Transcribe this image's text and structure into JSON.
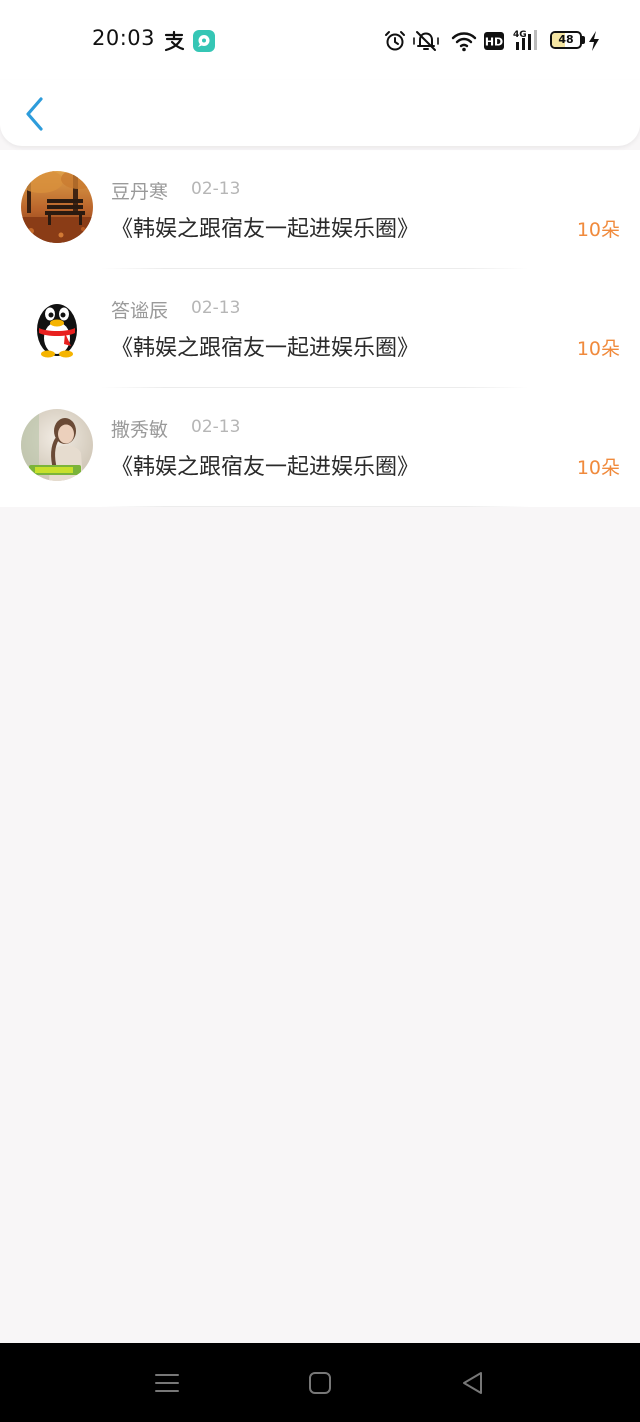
{
  "status_bar": {
    "time": "20:03",
    "battery_level": "48",
    "battery_fraction": 0.48,
    "left_icons": [
      "alipay-icon",
      "chat-app-icon"
    ],
    "right_icons": [
      "alarm-icon",
      "silent-icon",
      "wifi-icon",
      "hd-icon",
      "4g-signal-icon",
      "battery-icon",
      "charging-icon"
    ]
  },
  "header": {
    "back_icon": "chevron-left-icon",
    "accent_color": "#2d9cdb"
  },
  "records": [
    {
      "user": "豆丹寒",
      "date": "02-13",
      "title": "《韩娱之跟宿友一起进娱乐圈》",
      "amount": "10朵",
      "avatar": "autumn-park-bench-avatar"
    },
    {
      "user": "答谧辰",
      "date": "02-13",
      "title": "《韩娱之跟宿友一起进娱乐圈》",
      "amount": "10朵",
      "avatar": "qq-penguin-avatar"
    },
    {
      "user": "撒秀敏",
      "date": "02-13",
      "title": "《韩娱之跟宿友一起进娱乐圈》",
      "amount": "10朵",
      "avatar": "girl-photo-avatar"
    }
  ],
  "colors": {
    "amount": "#f08a3c",
    "name": "#9a9a9a",
    "date": "#b6b6b6",
    "background": "#f8f6f7"
  },
  "nav_bar": {
    "icons": [
      "menu-icon",
      "home-icon",
      "back-triangle-icon"
    ]
  }
}
